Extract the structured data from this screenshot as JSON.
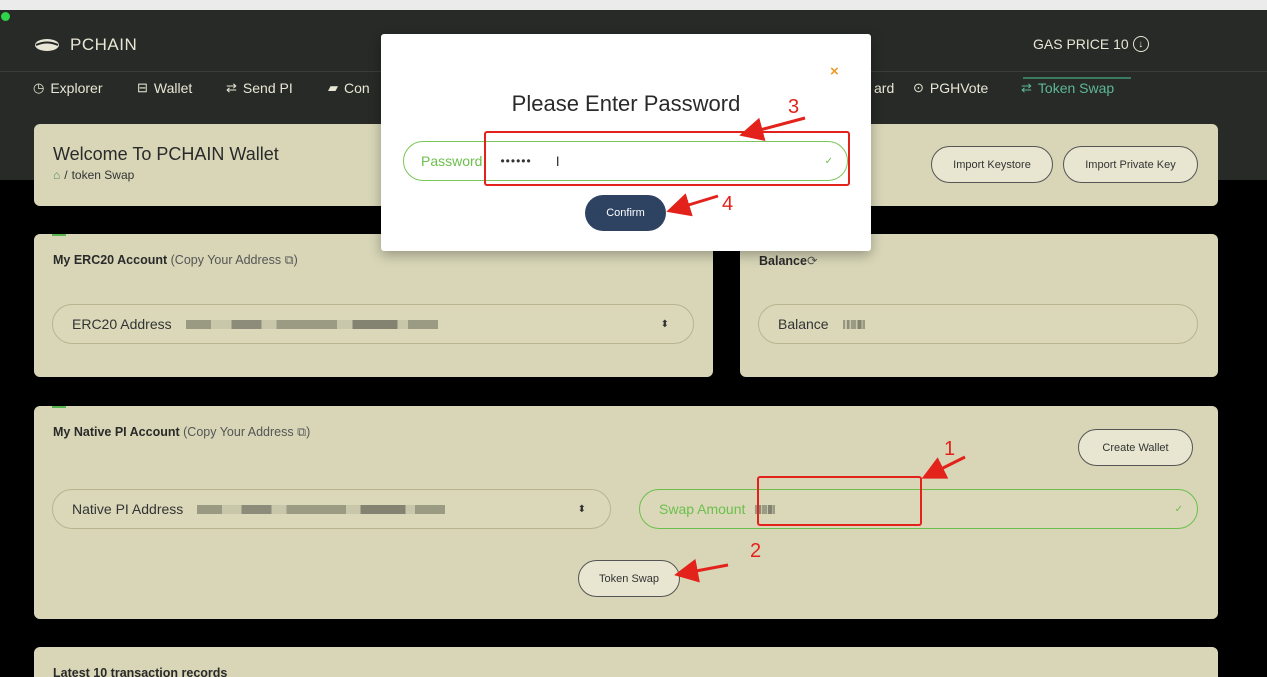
{
  "app": {
    "logo": "PCHAIN",
    "gas_price": "GAS PRICE 10",
    "gas_icon": "arrow-down-circle-icon"
  },
  "nav": [
    {
      "icon": "◷",
      "label": "Explorer"
    },
    {
      "icon": "⊟",
      "label": "Wallet"
    },
    {
      "icon": "⇄",
      "label": "Send PI"
    },
    {
      "icon": "▰",
      "label": "Con"
    },
    {
      "icon": "",
      "label": "ard"
    },
    {
      "icon": "⊙",
      "label": "PGHVote"
    },
    {
      "icon": "⇄",
      "label": "Token Swap"
    }
  ],
  "welcome": {
    "title": "Welcome To PCHAIN Wallet",
    "breadcrumb": "token Swap",
    "import_keystore": "Import Keystore",
    "import_private_key": "Import Private Key"
  },
  "erc20": {
    "heading": "My ERC20 Account",
    "copy": "(Copy Your Address",
    "copy_close": ")",
    "field_label": "ERC20 Address"
  },
  "balance": {
    "heading": "Balance",
    "field_label": "Balance"
  },
  "native": {
    "heading": "My Native PI Account",
    "copy": "(Copy Your Address",
    "copy_close": ")",
    "create_wallet": "Create Wallet",
    "field_label": "Native PI Address",
    "swap_label": "Swap Amount",
    "token_swap": "Token Swap"
  },
  "records": {
    "heading": "Latest 10 transaction records"
  },
  "modal": {
    "close": "×",
    "title": "Please Enter Password",
    "password_label": "Password",
    "password_value": "••••••",
    "confirm": "Confirm"
  },
  "annotations": {
    "one": "1",
    "two": "2",
    "three": "3",
    "four": "4"
  },
  "colors": {
    "accent_green": "#6cbf4c",
    "annotation_red": "#e3221b",
    "panel": "#d8d6b7",
    "header": "#272a26",
    "confirm_btn": "#2e4262"
  }
}
